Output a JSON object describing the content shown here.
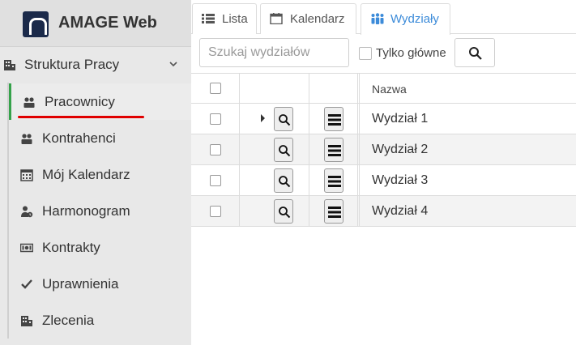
{
  "app": {
    "name": "AMAGE Web"
  },
  "sidebar": {
    "group": {
      "label": "Struktura Pracy"
    },
    "items": [
      {
        "label": "Pracownicy",
        "icon": "users-icon",
        "active": true
      },
      {
        "label": "Kontrahenci",
        "icon": "users-icon"
      },
      {
        "label": "Mój Kalendarz",
        "icon": "calendar-icon"
      },
      {
        "label": "Harmonogram",
        "icon": "user-clock-icon"
      },
      {
        "label": "Kontrakty",
        "icon": "money-icon"
      },
      {
        "label": "Uprawnienia",
        "icon": "check-icon"
      },
      {
        "label": "Zlecenia",
        "icon": "building-icon"
      }
    ]
  },
  "tabs": [
    {
      "label": "Lista",
      "icon": "list-icon"
    },
    {
      "label": "Kalendarz",
      "icon": "calendar-icon"
    },
    {
      "label": "Wydziały",
      "icon": "people-icon",
      "active": true
    }
  ],
  "toolbar": {
    "search_placeholder": "Szukaj wydziałów",
    "search_value": "",
    "only_main_label": "Tylko główne",
    "only_main_checked": false
  },
  "table": {
    "header_name": "Nazwa",
    "rows": [
      {
        "name": "Wydział 1",
        "expandable": true
      },
      {
        "name": "Wydział 2"
      },
      {
        "name": "Wydział 3"
      },
      {
        "name": "Wydział 4"
      }
    ]
  },
  "colors": {
    "accent": "#3c8bd9",
    "active_bar": "#35a24a",
    "highlight": "#e00000"
  }
}
